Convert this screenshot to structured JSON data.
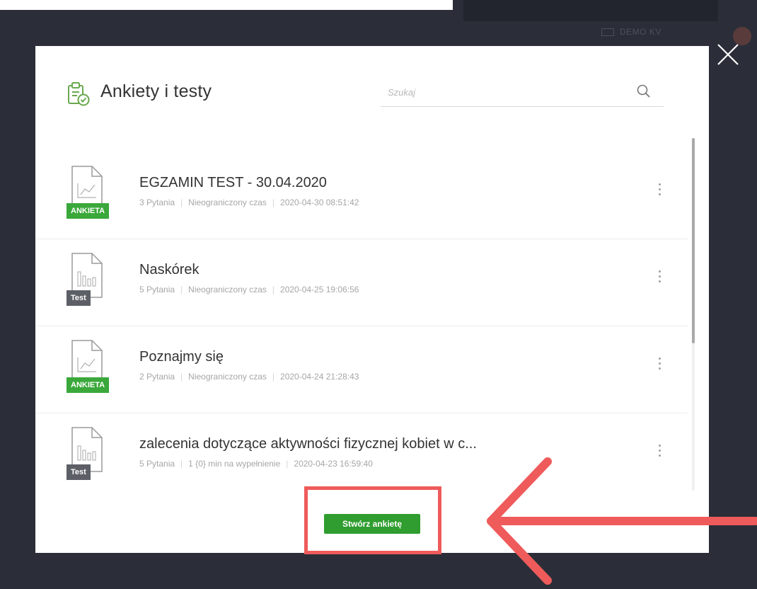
{
  "background": {
    "top_right_label": "DEMO KV"
  },
  "modal": {
    "title": "Ankiety i testy",
    "search": {
      "placeholder": "Szukaj",
      "value": ""
    },
    "items": [
      {
        "badge": "ANKIETA",
        "badge_type": "ankieta",
        "file_icon": "line-chart-file-icon",
        "title": "EGZAMIN TEST - 30.04.2020",
        "questions": "3 Pytania",
        "time": "Nieograniczony czas",
        "date": "2020-04-30 08:51:42"
      },
      {
        "badge": "Test",
        "badge_type": "test",
        "file_icon": "bar-chart-file-icon",
        "title": "Naskórek",
        "questions": "5 Pytania",
        "time": "Nieograniczony czas",
        "date": "2020-04-25 19:06:56"
      },
      {
        "badge": "ANKIETA",
        "badge_type": "ankieta",
        "file_icon": "line-chart-file-icon",
        "title": "Poznajmy się",
        "questions": "2 Pytania",
        "time": "Nieograniczony czas",
        "date": "2020-04-24 21:28:43"
      },
      {
        "badge": "Test",
        "badge_type": "test",
        "file_icon": "bar-chart-file-icon",
        "title": "zalecenia dotyczące aktywności fizycznej kobiet w c...",
        "questions": "5 Pytania",
        "time": "1 {0} min na wypełnienie",
        "date": "2020-04-23 16:59:40"
      }
    ],
    "create_button_label": "Stwórz ankietę"
  },
  "colors": {
    "ankieta_badge": "#3aa83a",
    "test_badge": "#5c5f66",
    "create_button": "#2f9d2f",
    "highlight": "#ef5b5b",
    "backdrop": "#2b2e38"
  }
}
